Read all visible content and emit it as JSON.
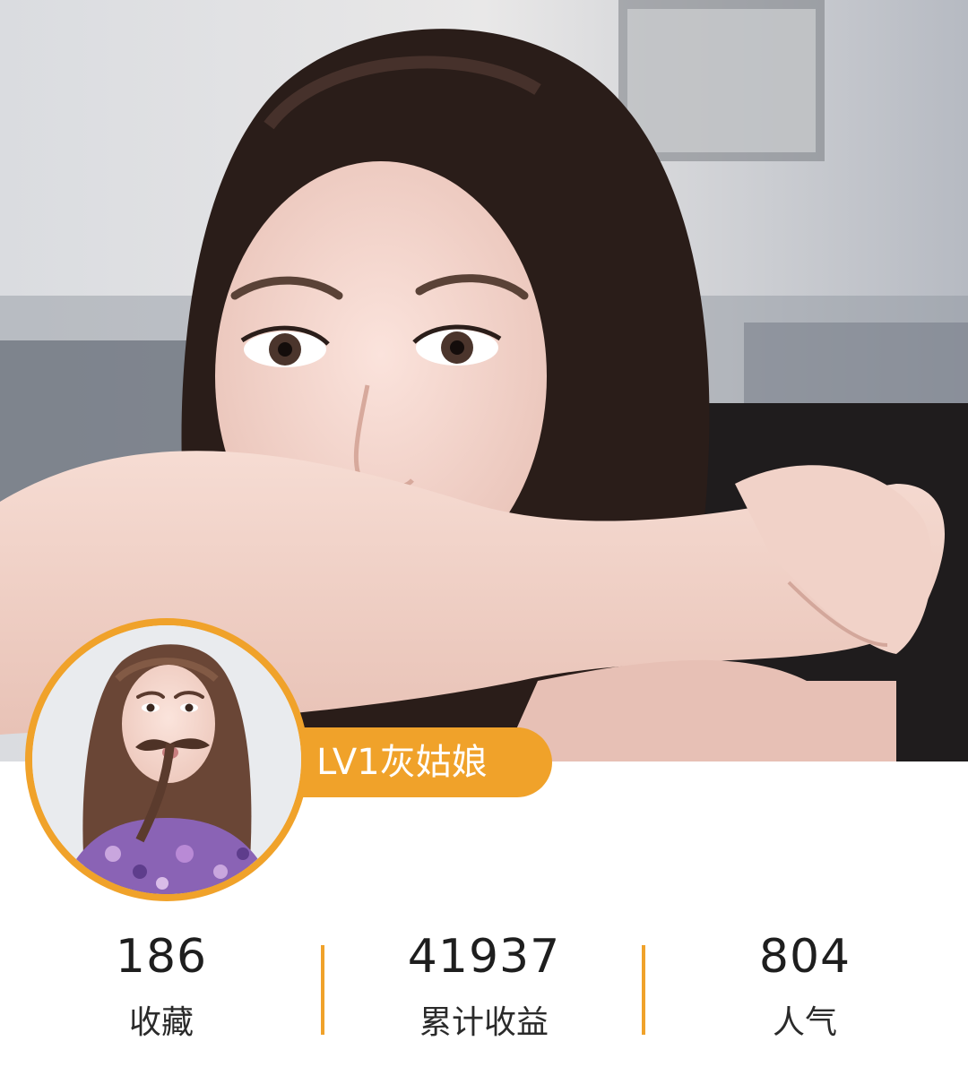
{
  "profile": {
    "badge_text": "LV1灰姑娘",
    "accent_color": "#f0a22a"
  },
  "stats": {
    "favorites": {
      "value": "186",
      "label": "收藏"
    },
    "earnings": {
      "value": "41937",
      "label": "累计收益"
    },
    "popularity": {
      "value": "804",
      "label": "人气"
    }
  }
}
